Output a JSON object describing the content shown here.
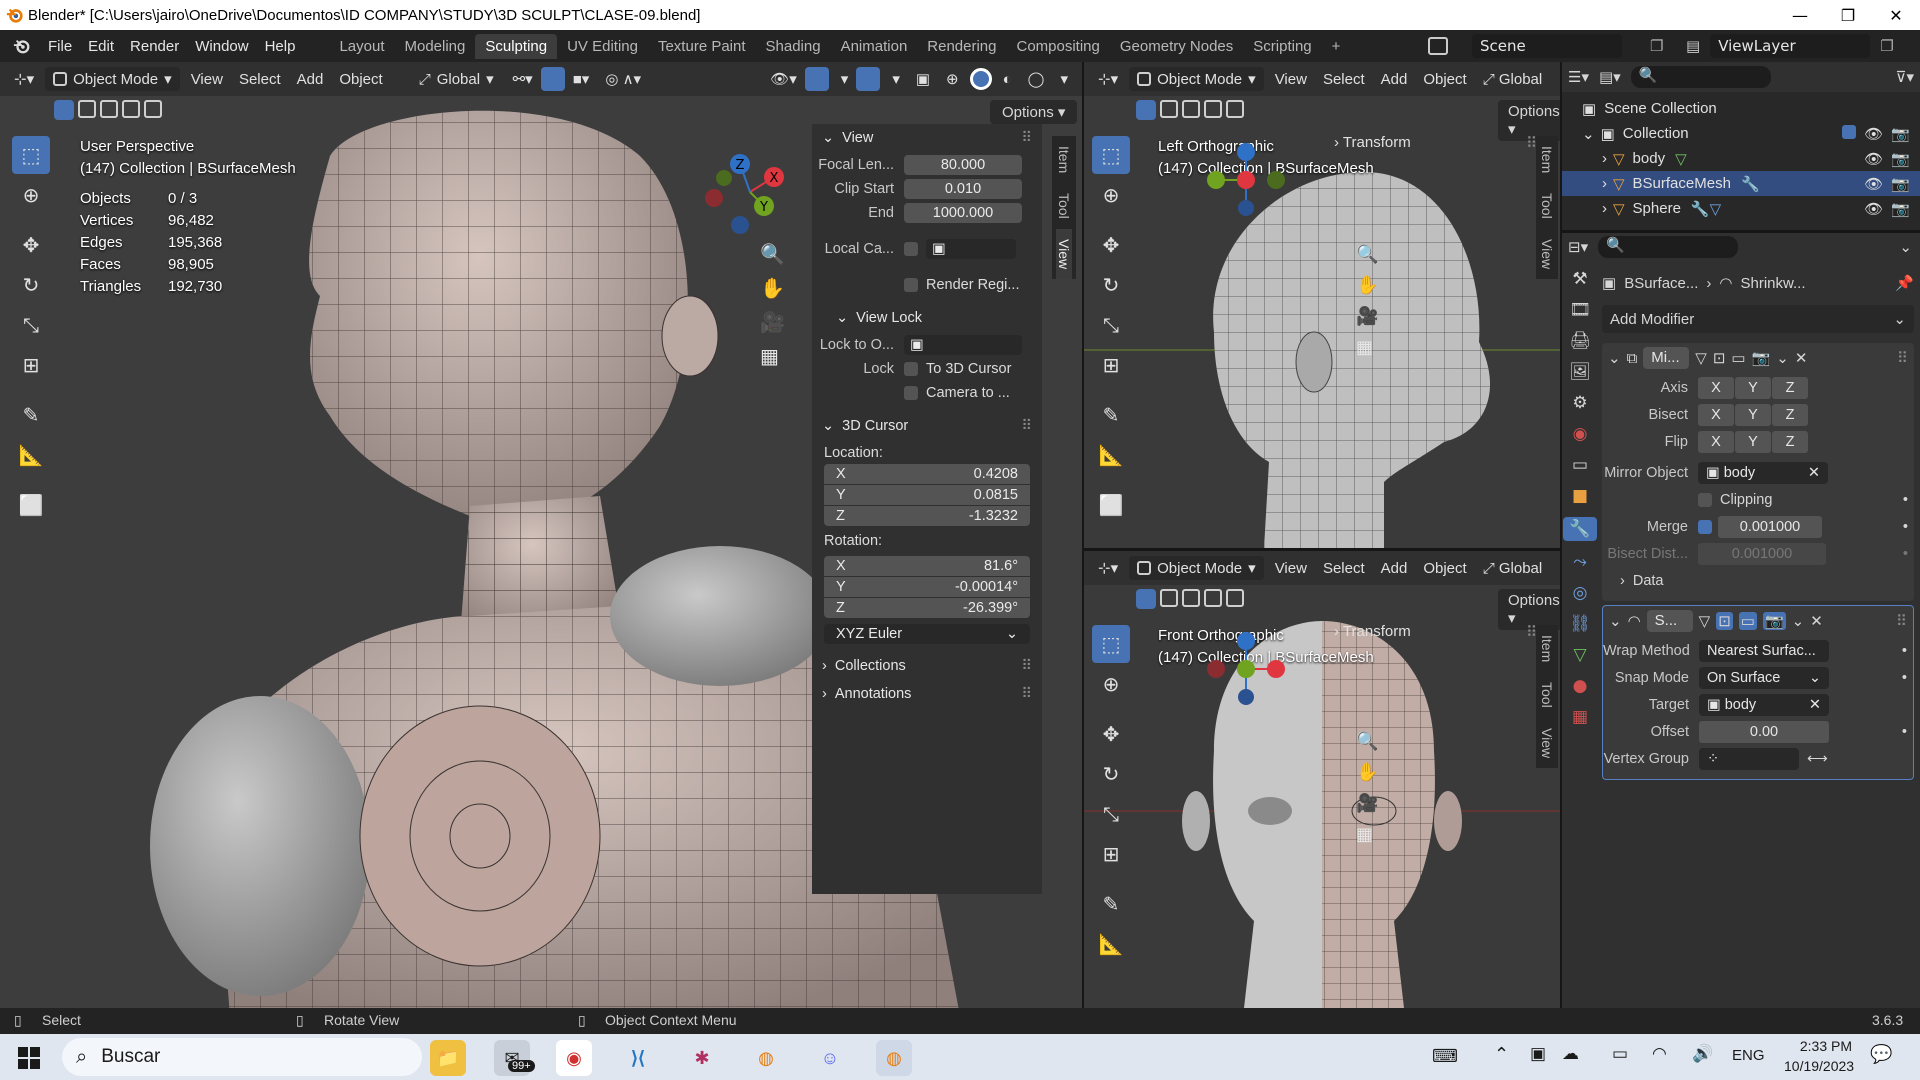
{
  "window": {
    "title": "Blender* [C:\\Users\\jairo\\OneDrive\\Documentos\\ID COMPANY\\STUDY\\3D SCULPT\\CLASE-09.blend]",
    "controls": [
      "—",
      "❐",
      "✕"
    ]
  },
  "menu": [
    "File",
    "Edit",
    "Render",
    "Window",
    "Help"
  ],
  "workspaces": [
    {
      "label": "Layout"
    },
    {
      "label": "Modeling"
    },
    {
      "label": "Sculpting",
      "active": true
    },
    {
      "label": "UV Editing"
    },
    {
      "label": "Texture Paint"
    },
    {
      "label": "Shading"
    },
    {
      "label": "Animation"
    },
    {
      "label": "Rendering"
    },
    {
      "label": "Compositing"
    },
    {
      "label": "Geometry Nodes"
    },
    {
      "label": "Scripting"
    }
  ],
  "add_workspace": "+",
  "scene": "Scene",
  "view_layer": "ViewLayer",
  "main_viewport": {
    "mode": "Object Mode",
    "menus": [
      "View",
      "Select",
      "Add",
      "Object"
    ],
    "orientation": "Global",
    "options": "Options",
    "perspective": "User Perspective",
    "collection": "(147) Collection | BSurfaceMesh",
    "stats": [
      {
        "label": "Objects",
        "value": "0 / 3"
      },
      {
        "label": "Vertices",
        "value": "96,482"
      },
      {
        "label": "Edges",
        "value": "195,368"
      },
      {
        "label": "Faces",
        "value": "98,905"
      },
      {
        "label": "Triangles",
        "value": "192,730"
      }
    ],
    "gizmo": {
      "x": "X",
      "y": "Y",
      "z": "Z"
    }
  },
  "npanel": {
    "tabs": [
      "Item",
      "Tool",
      "View"
    ],
    "view_header": "View",
    "focal_length_label": "Focal Len...",
    "focal_length": "80.000",
    "clip_start_label": "Clip Start",
    "clip_start": "0.010",
    "clip_end_label": "End",
    "clip_end": "1000.000",
    "local_camera_label": "Local Ca...",
    "render_region_label": "Render Regi...",
    "view_lock_header": "View Lock",
    "lock_to_object_label": "Lock to O...",
    "lock_label": "Lock",
    "to_3d_cursor": "To 3D Cursor",
    "camera_to": "Camera to ...",
    "cursor_header": "3D Cursor",
    "location_label": "Location:",
    "location": {
      "x": "0.4208",
      "y": "0.0815",
      "z": "-1.3232"
    },
    "rotation_label": "Rotation:",
    "rotation": {
      "x": "81.6°",
      "y": "-0.00014°",
      "z": "-26.399°"
    },
    "rotation_mode": "XYZ Euler",
    "collections_header": "Collections",
    "annotations_header": "Annotations",
    "axis_labels": {
      "x": "X",
      "y": "Y",
      "z": "Z"
    }
  },
  "side_viewport_top": {
    "mode": "Object Mode",
    "menus": [
      "View",
      "Select",
      "Add",
      "Object"
    ],
    "orientation": "Global",
    "options": "Options",
    "label": "Left Orthographic",
    "collection": "(147) Collection | BSurfaceMesh",
    "transform": "Transform",
    "tabs": [
      "Item",
      "Tool",
      "View"
    ]
  },
  "side_viewport_bottom": {
    "mode": "Object Mode",
    "menus": [
      "View",
      "Select",
      "Add",
      "Object"
    ],
    "orientation": "Global",
    "options": "Options",
    "label": "Front Orthographic",
    "collection": "(147) Collection | BSurfaceMesh",
    "transform": "Transform",
    "tabs": [
      "Item",
      "Tool",
      "View"
    ]
  },
  "outliner": {
    "scene_collection": "Scene Collection",
    "collection": "Collection",
    "items": [
      "body",
      "BSurfaceMesh",
      "Sphere"
    ]
  },
  "properties": {
    "breadcrumb_object": "BSurface...",
    "breadcrumb_modifier": "Shrinkw...",
    "add_modifier": "Add Modifier",
    "mirror": {
      "name": "Mi...",
      "axis_label": "Axis",
      "bisect_label": "Bisect",
      "flip_label": "Flip",
      "xyz": [
        "X",
        "Y",
        "Z"
      ],
      "mirror_object_label": "Mirror Object",
      "mirror_object": "body",
      "clipping": "Clipping",
      "merge_label": "Merge",
      "merge_value": "0.001000",
      "bisect_dist_label": "Bisect Dist...",
      "bisect_dist": "0.001000",
      "data": "Data"
    },
    "shrinkwrap": {
      "name": "S...",
      "wrap_method_label": "Wrap Method",
      "wrap_method": "Nearest Surfac...",
      "snap_mode_label": "Snap Mode",
      "snap_mode": "On Surface",
      "target_label": "Target",
      "target": "body",
      "offset_label": "Offset",
      "offset": "0.00",
      "vertex_group_label": "Vertex Group"
    }
  },
  "status": {
    "select": "Select",
    "rotate": "Rotate View",
    "context": "Object Context Menu",
    "version": "3.6.3"
  },
  "taskbar": {
    "search": "Buscar",
    "badge": "99+",
    "lang": "ENG",
    "time": "2:33 PM",
    "date": "10/19/2023"
  },
  "colors": {
    "accent": "#4772b3",
    "x_axis": "#e0363f",
    "y_axis": "#70a31f",
    "z_axis": "#2f71c6",
    "bg_viewport": "#3a3a3a"
  }
}
